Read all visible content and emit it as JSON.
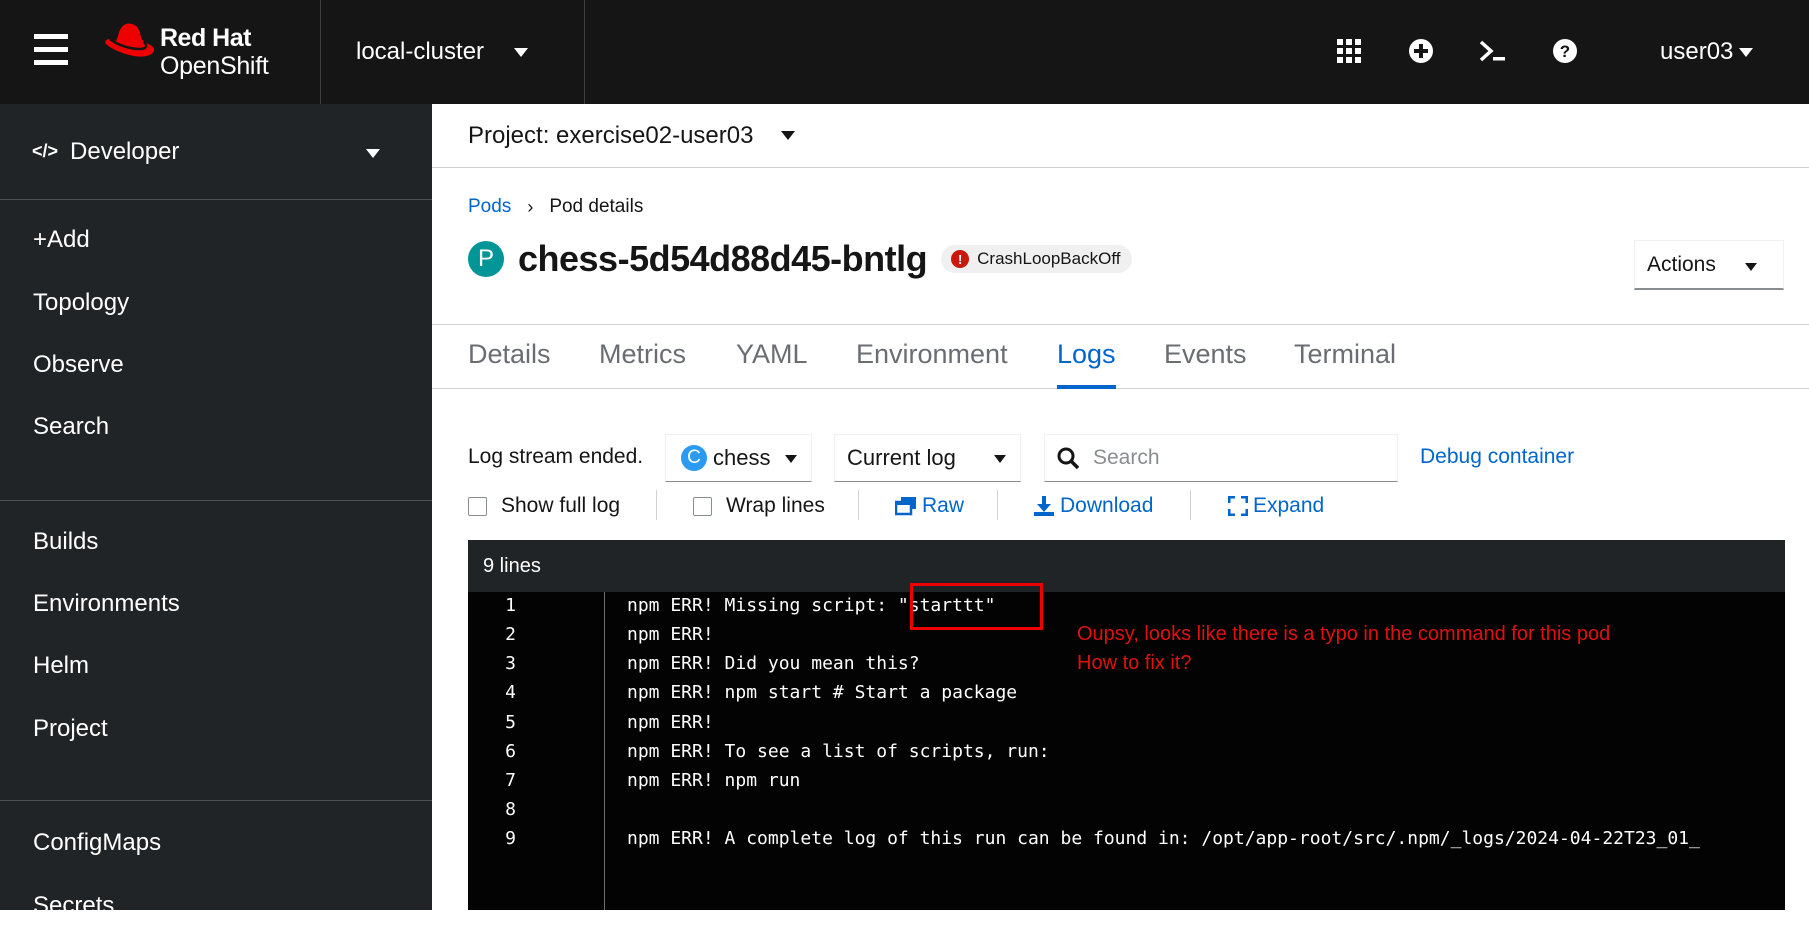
{
  "masthead": {
    "logo_line1": "Red Hat",
    "logo_line2": "OpenShift",
    "cluster": "local-cluster",
    "icons": [
      "apps-grid-icon",
      "plus-circle-icon",
      "terminal-icon",
      "help-icon"
    ],
    "user": "user03"
  },
  "sidebar": {
    "perspective": "Developer",
    "items": [
      {
        "label": "+Add"
      },
      {
        "label": "Topology"
      },
      {
        "label": "Observe"
      },
      {
        "label": "Search"
      },
      {
        "label": "Builds"
      },
      {
        "label": "Environments"
      },
      {
        "label": "Helm"
      },
      {
        "label": "Project"
      },
      {
        "label": "ConfigMaps"
      },
      {
        "label": "Secrets"
      }
    ]
  },
  "project": {
    "label": "Project: exercise02-user03"
  },
  "breadcrumb": {
    "parent": "Pods",
    "current": "Pod details"
  },
  "pod": {
    "badge": "P",
    "name": "chess-5d54d88d45-bntlg",
    "status": "CrashLoopBackOff",
    "status_color": "#c9190b",
    "actions_label": "Actions"
  },
  "tabs": [
    {
      "label": "Details"
    },
    {
      "label": "Metrics"
    },
    {
      "label": "YAML"
    },
    {
      "label": "Environment"
    },
    {
      "label": "Logs",
      "active": true
    },
    {
      "label": "Events"
    },
    {
      "label": "Terminal"
    }
  ],
  "log_toolbar": {
    "stream_status": "Log stream ended.",
    "container_badge": "C",
    "container": "chess",
    "log_select": "Current log",
    "search_placeholder": "Search",
    "debug_link": "Debug container",
    "show_full_log": "Show full log",
    "wrap_lines": "Wrap lines",
    "raw": "Raw",
    "download": "Download",
    "expand": "Expand"
  },
  "log": {
    "header": "9 lines",
    "lines": [
      {
        "num": "1",
        "text": "npm ERR! Missing script: \"starttt\""
      },
      {
        "num": "2",
        "text": "npm ERR!"
      },
      {
        "num": "3",
        "text": "npm ERR! Did you mean this?"
      },
      {
        "num": "4",
        "text": "npm ERR! npm start # Start a package"
      },
      {
        "num": "5",
        "text": "npm ERR!"
      },
      {
        "num": "6",
        "text": "npm ERR! To see a list of scripts, run:"
      },
      {
        "num": "7",
        "text": "npm ERR! npm run"
      },
      {
        "num": "8",
        "text": ""
      },
      {
        "num": "9",
        "text": "npm ERR! A complete log of this run can be found in: /opt/app-root/src/.npm/_logs/2024-04-22T23_01_"
      }
    ]
  },
  "annotation": {
    "line1": "Oupsy, looks like there is a typo in the command for this pod",
    "line2": "How to fix it?",
    "color": "#e01010"
  },
  "colors": {
    "accent": "#0066cc",
    "masthead": "#151515",
    "sidebar": "#212427",
    "pod_badge": "#009596",
    "container_badge": "#2b9af3"
  }
}
